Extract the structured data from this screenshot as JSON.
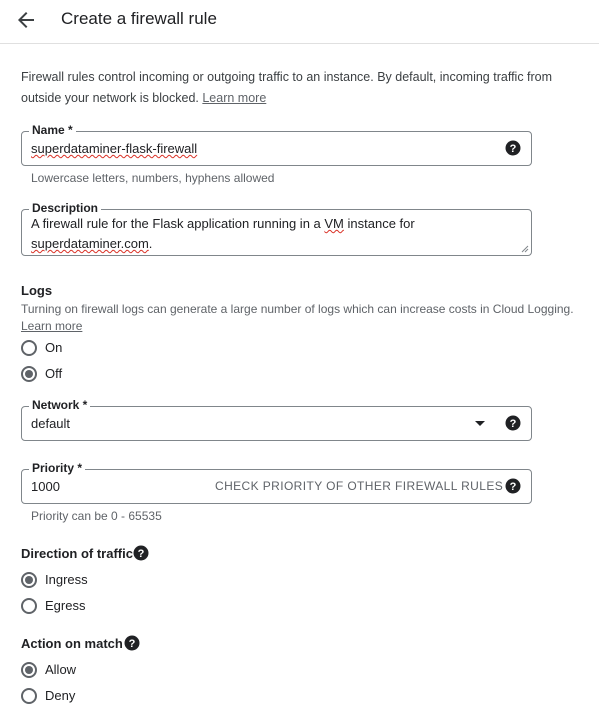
{
  "header": {
    "title": "Create a firewall rule"
  },
  "intro": {
    "text": "Firewall rules control incoming or outgoing traffic to an instance. By default, incoming traffic from outside your network is blocked.",
    "link": "Learn more"
  },
  "name_field": {
    "label": "Name *",
    "value": "superdataminer-flask-firewall",
    "hint": "Lowercase letters, numbers, hyphens allowed"
  },
  "description_field": {
    "label": "Description",
    "value_before": "A firewall rule for the Flask application running in a ",
    "value_vm": "VM",
    "value_mid": " instance for ",
    "value_domain": "superdataminer.com",
    "value_end": "."
  },
  "logs": {
    "title": "Logs",
    "text": "Turning on firewall logs can generate a large number of logs which can increase costs in Cloud Logging.",
    "link": "Learn more",
    "options": [
      {
        "label": "On",
        "checked": false
      },
      {
        "label": "Off",
        "checked": true
      }
    ]
  },
  "network_field": {
    "label": "Network *",
    "value": "default"
  },
  "priority_field": {
    "label": "Priority *",
    "value": "1000",
    "button": "CHECK PRIORITY OF OTHER FIREWALL RULES",
    "hint": "Priority can be 0 - 65535"
  },
  "direction": {
    "title": "Direction of traffic",
    "options": [
      {
        "label": "Ingress",
        "checked": true
      },
      {
        "label": "Egress",
        "checked": false
      }
    ]
  },
  "action": {
    "title": "Action on match",
    "options": [
      {
        "label": "Allow",
        "checked": true
      },
      {
        "label": "Deny",
        "checked": false
      }
    ]
  },
  "colors": {
    "text": "#202124",
    "secondary_text": "#5f6368",
    "border": "#80868b",
    "spellcheck": "#d93025"
  },
  "icons": [
    "arrow-back-icon",
    "help-icon",
    "dropdown-arrow-icon"
  ]
}
